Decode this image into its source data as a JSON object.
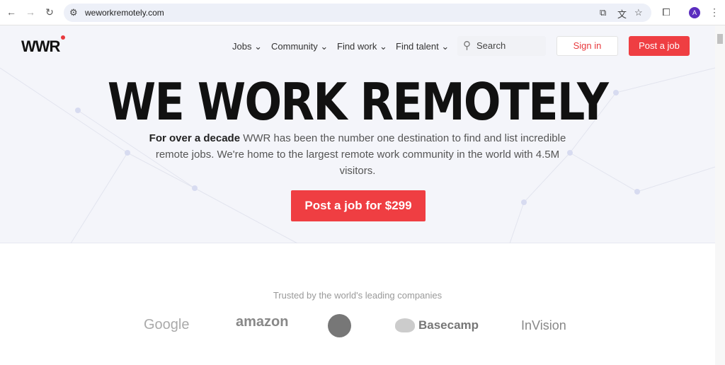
{
  "browser": {
    "url": "weworkremotely.com",
    "avatar_letter": "A"
  },
  "header": {
    "logo": "WWR",
    "nav": [
      "Jobs",
      "Community",
      "Find work",
      "Find talent"
    ],
    "search_placeholder": "Search",
    "sign_in": "Sign in",
    "post_job": "Post a job"
  },
  "hero": {
    "title": "WE WORK REMOTELY",
    "desc_bold": "For over a decade",
    "desc_rest": " WWR has been the number one destination to find and list incredible remote jobs. We're home to the largest remote work community in the world with 4.5M visitors.",
    "cta": "Post a job for $299"
  },
  "trusted": {
    "label": "Trusted by the world's leading companies",
    "companies": [
      "Google",
      "amazon",
      "GitHub",
      "Basecamp",
      "InVision"
    ]
  },
  "colors": {
    "accent": "#ef3e42"
  }
}
